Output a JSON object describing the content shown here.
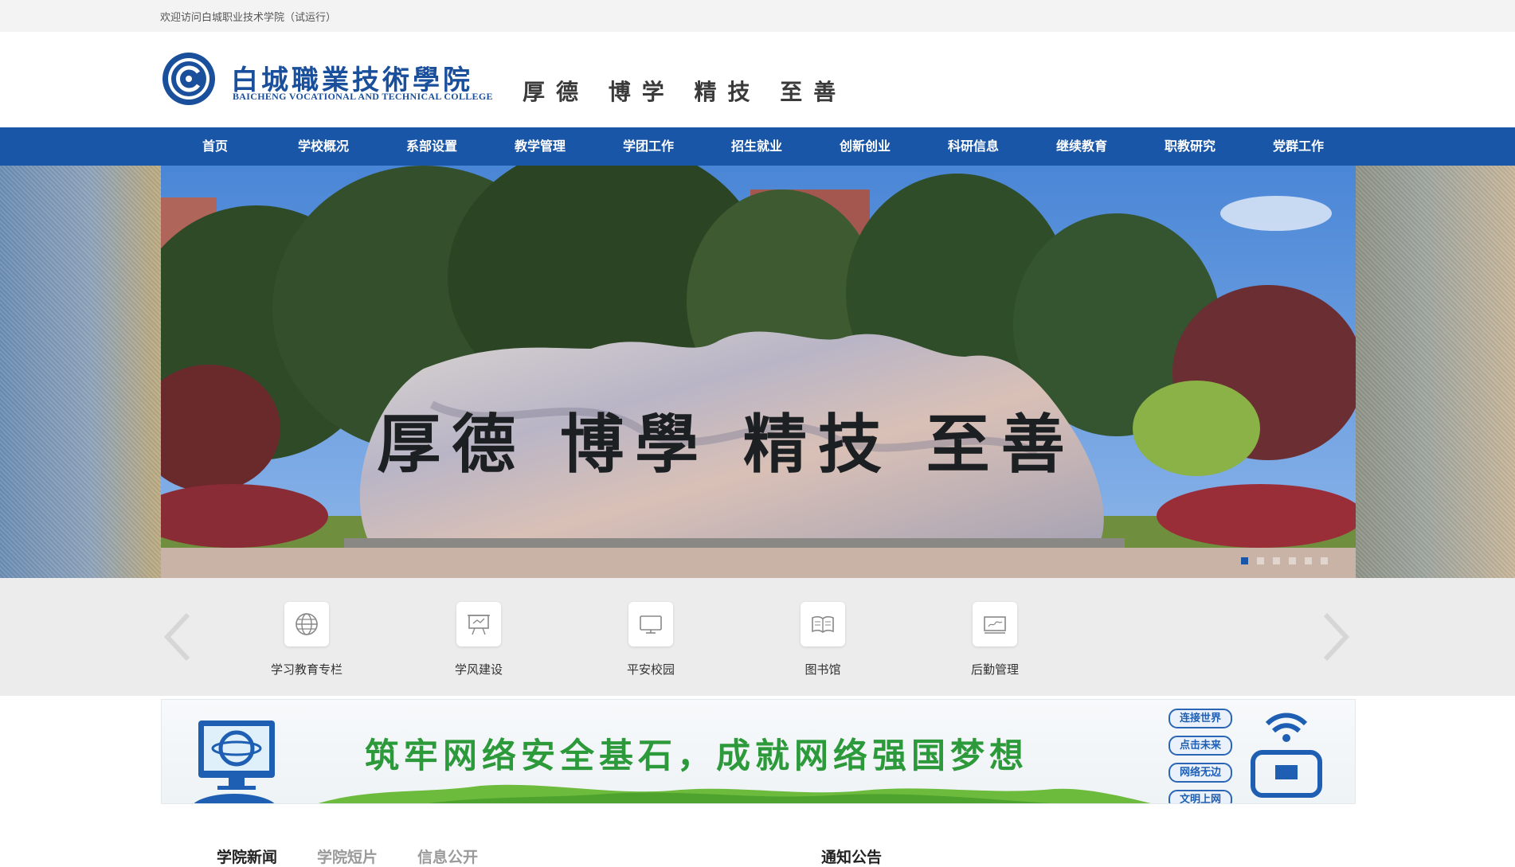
{
  "topbar": {
    "welcome": "欢迎访问白城职业技术学院（试运行）"
  },
  "header": {
    "college_name": "白城職業技術學院",
    "college_name_en": "BAICHENG VOCATIONAL AND TECHNICAL COLLEGE",
    "motto": "厚德 博学 精技 至善"
  },
  "nav": {
    "items": [
      {
        "label": "首页"
      },
      {
        "label": "学校概况"
      },
      {
        "label": "系部设置"
      },
      {
        "label": "教学管理"
      },
      {
        "label": "学团工作"
      },
      {
        "label": "招生就业"
      },
      {
        "label": "创新创业"
      },
      {
        "label": "科研信息"
      },
      {
        "label": "继续教育"
      },
      {
        "label": "职教研究"
      },
      {
        "label": "党群工作"
      }
    ]
  },
  "banner": {
    "stone_inscription": "厚德 博學 精技 至善",
    "slide_count": 6,
    "active_slide": 1
  },
  "quick_links": {
    "items": [
      {
        "label": "学习教育专栏",
        "icon": "globe-icon"
      },
      {
        "label": "学风建设",
        "icon": "presentation-board-icon"
      },
      {
        "label": "平安校园",
        "icon": "monitor-icon"
      },
      {
        "label": "图书馆",
        "icon": "book-icon"
      },
      {
        "label": "后勤管理",
        "icon": "chalkboard-icon"
      }
    ]
  },
  "security_banner": {
    "slogan": "筑牢网络安全基石，成就网络强国梦想",
    "pills": [
      "连接世界",
      "点击未来",
      "网络无边",
      "文明上网"
    ]
  },
  "news_tabs": {
    "tabs": [
      "学院新闻",
      "学院短片",
      "信息公开"
    ],
    "active": 0
  },
  "notice": {
    "title": "通知公告"
  },
  "colors": {
    "brand_blue": "#1a56a8",
    "slogan_green": "#2c9a3a",
    "tab_active": "#222222",
    "tab_inactive": "#9a9a9a"
  }
}
